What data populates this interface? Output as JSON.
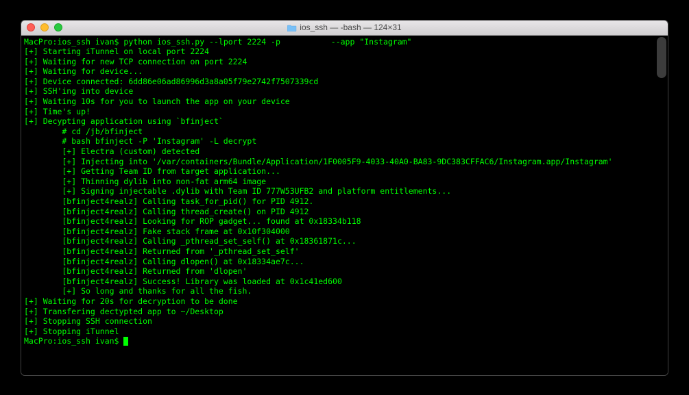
{
  "window": {
    "title": "ios_ssh — -bash — 124×31"
  },
  "prompt": {
    "host": "MacPro:ios_ssh ivan$",
    "command": "python ios_ssh.py --lport 2224 -p",
    "command_tail": "--app \"Instagram\""
  },
  "lines": [
    "[+] Starting iTunnel on local port 2224",
    "[+] Waiting for new TCP connection on port 2224",
    "[+] Waiting for device...",
    "[+] Device connected: 6dd86e06ad86996d3a8a05f79e2742f7507339cd",
    "[+] SSH'ing into device",
    "[+] Waiting 10s for you to launch the app on your device",
    "[+] Time's up!",
    "[+] Decypting application using `bfinject`",
    "        # cd /jb/bfinject",
    "        # bash bfinject -P 'Instagram' -L decrypt",
    "        [+] Electra (custom) detected",
    "        [+] Injecting into '/var/containers/Bundle/Application/1F0005F9-4033-40A0-BA83-9DC383CFFAC6/Instagram.app/Instagram'",
    "        [+] Getting Team ID from target application...",
    "        [+] Thinning dylib into non-fat arm64 image",
    "        [+] Signing injectable .dylib with Team ID 777W53UFB2 and platform entitlements...",
    "        [bfinject4realz] Calling task_for_pid() for PID 4912.",
    "        [bfinject4realz] Calling thread_create() on PID 4912",
    "        [bfinject4realz] Looking for ROP gadget... found at 0x18334b118",
    "        [bfinject4realz] Fake stack frame at 0x10f304000",
    "        [bfinject4realz] Calling _pthread_set_self() at 0x18361871c...",
    "        [bfinject4realz] Returned from '_pthread_set_self'",
    "        [bfinject4realz] Calling dlopen() at 0x18334ae7c...",
    "        [bfinject4realz] Returned from 'dlopen'",
    "        [bfinject4realz] Success! Library was loaded at 0x1c41ed600",
    "        [+] So long and thanks for all the fish.",
    "[+] Waiting for 20s for decryption to be done",
    "[+] Transfering dectypted app to ~/Desktop",
    "[+] Stopping SSH connection",
    "[+] Stopping iTunnel"
  ],
  "prompt2": {
    "host": "MacPro:ios_ssh ivan$"
  }
}
